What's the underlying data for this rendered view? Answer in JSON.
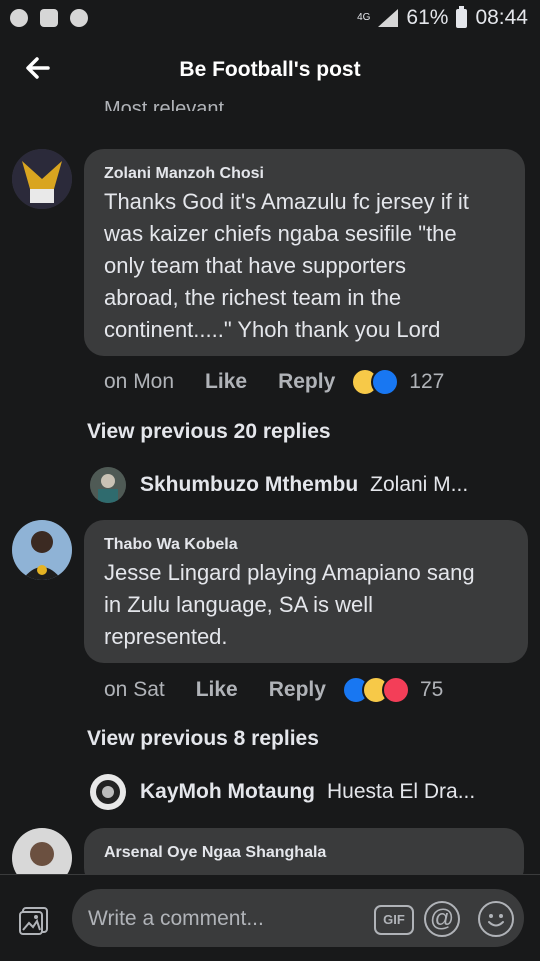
{
  "status_bar": {
    "network": "4G",
    "battery": "61%",
    "time": "08:44"
  },
  "header": {
    "title": "Be Football's post"
  },
  "sort": {
    "label": "Most relevant"
  },
  "comments": [
    {
      "author": "Zolani Manzoh Chosi",
      "text": "Thanks God it's Amazulu fc jersey if it was kaizer chiefs ngaba sesifile \"the only team that have supporters abroad, the richest team in the continent.....\" Yhoh thank you Lord",
      "lines": [
        "Thanks God it's Amazulu fc jersey if it",
        "was kaizer chiefs ngaba sesifile \"the",
        "only team that have supporters",
        "abroad, the richest team in the",
        "continent.....\" Yhoh thank you Lord"
      ],
      "time": "on Mon",
      "like_label": "Like",
      "reply_label": "Reply",
      "reactions": [
        "haha-icon",
        "like-icon"
      ],
      "reaction_count": "127",
      "view_previous": "View previous 20 replies",
      "latest_reply": {
        "author": "Skhumbuzo Mthembu",
        "text": "Zolani M..."
      }
    },
    {
      "author": "Thabo Wa Kobela",
      "text": "Jesse Lingard playing Amapiano sang in Zulu language, SA is well represented.",
      "lines": [
        "Jesse Lingard playing Amapiano sang",
        "in Zulu language, SA is well",
        "represented."
      ],
      "time": "on Sat",
      "like_label": "Like",
      "reply_label": "Reply",
      "reactions": [
        "like-icon",
        "haha-icon",
        "love-icon"
      ],
      "reaction_count": "75",
      "view_previous": "View previous 8 replies",
      "latest_reply": {
        "author": "KayMoh Motaung",
        "text": "Huesta El Dra..."
      }
    },
    {
      "author": "Arsenal Oye Ngaa Shanghala",
      "lines": []
    }
  ],
  "composer": {
    "placeholder": "Write a comment...",
    "gif_label": "GIF",
    "at_label": "@"
  },
  "colors": {
    "background": "#18191a",
    "bubble": "#3a3b3c",
    "like_blue": "#1877f2",
    "haha_yellow": "#f7c948",
    "love_red": "#f33e58"
  }
}
